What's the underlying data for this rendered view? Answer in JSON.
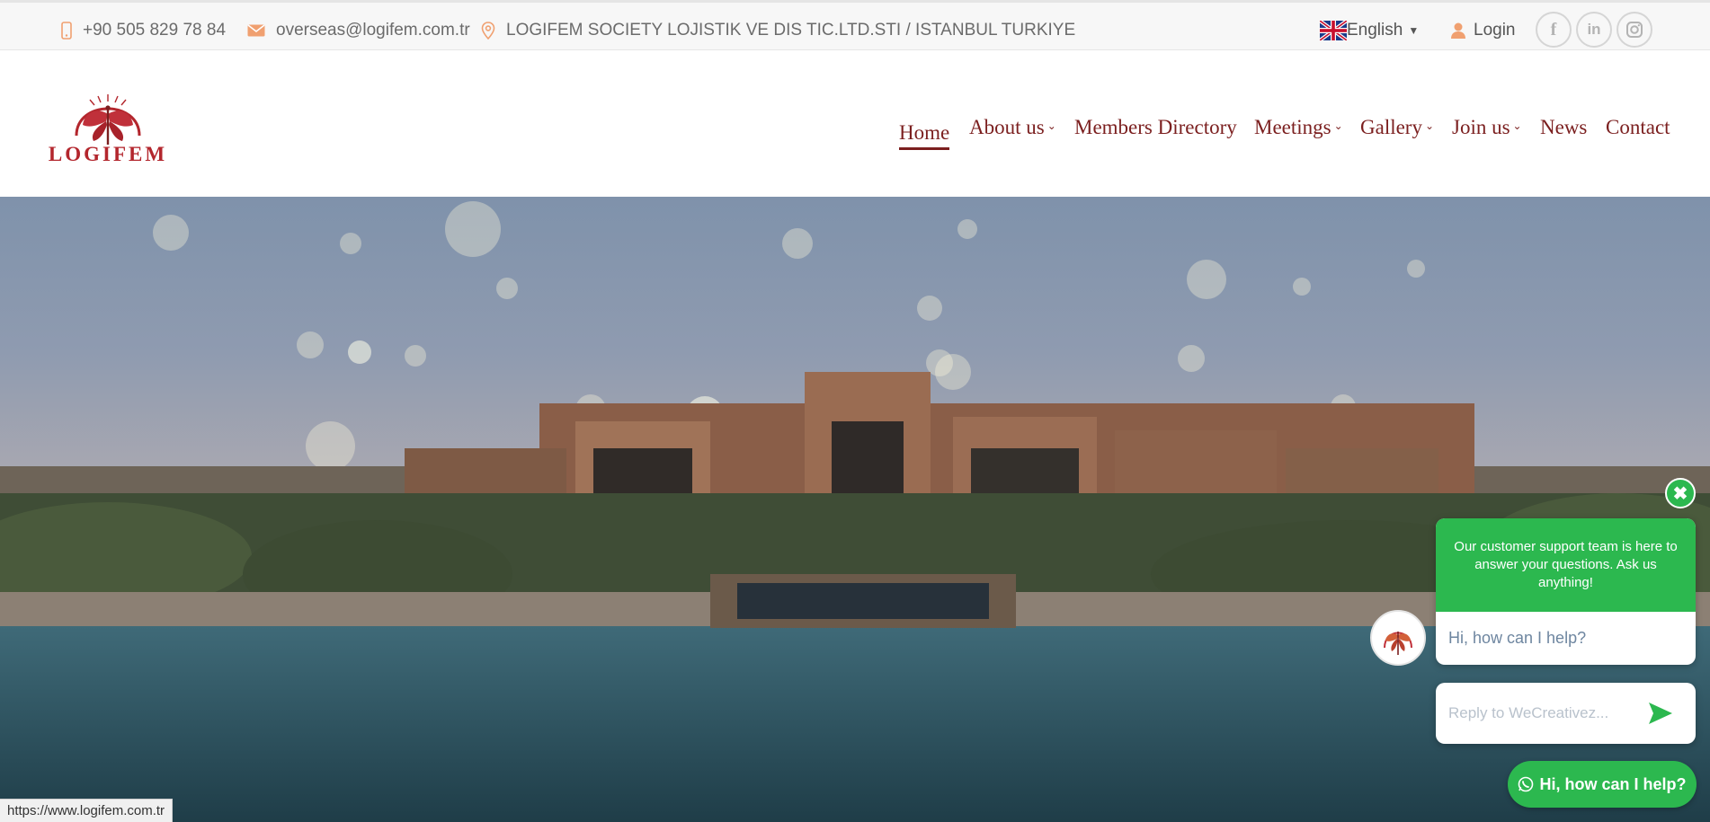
{
  "topbar": {
    "phone": "+90 505 829 78 84",
    "email": "overseas@logifem.com.tr",
    "address": "LOGIFEM SOCIETY LOJISTIK VE DIS TIC.LTD.STI / ISTANBUL TURKIYE",
    "language": "English",
    "login": "Login",
    "social": {
      "facebook": "f",
      "linkedin": "in",
      "instagram": "ig"
    }
  },
  "header": {
    "logo_text": "LOGIFEM",
    "nav": [
      {
        "label": "Home",
        "active": true
      },
      {
        "label": "About us",
        "dropdown": true
      },
      {
        "label": "Members Directory"
      },
      {
        "label": "Meetings",
        "dropdown": true
      },
      {
        "label": "Gallery",
        "dropdown": true
      },
      {
        "label": "Join us",
        "dropdown": true
      },
      {
        "label": "News"
      },
      {
        "label": "Contact"
      }
    ]
  },
  "chat": {
    "close": "✖",
    "intro": "Our customer support team is here to answer your questions. Ask us anything!",
    "greeting": "Hi, how can I help?",
    "reply_placeholder": "Reply to WeCreativez...",
    "whatsapp_button": "Hi, how can I help?"
  },
  "status_bar": {
    "url": "https://www.logifem.com.tr"
  },
  "colors": {
    "brand": "#7b1f1f",
    "logo_red": "#b3262d",
    "chat_green": "#2cb84f",
    "topbar_text": "#6b6b6b",
    "icon_orange": "#f0a070"
  }
}
